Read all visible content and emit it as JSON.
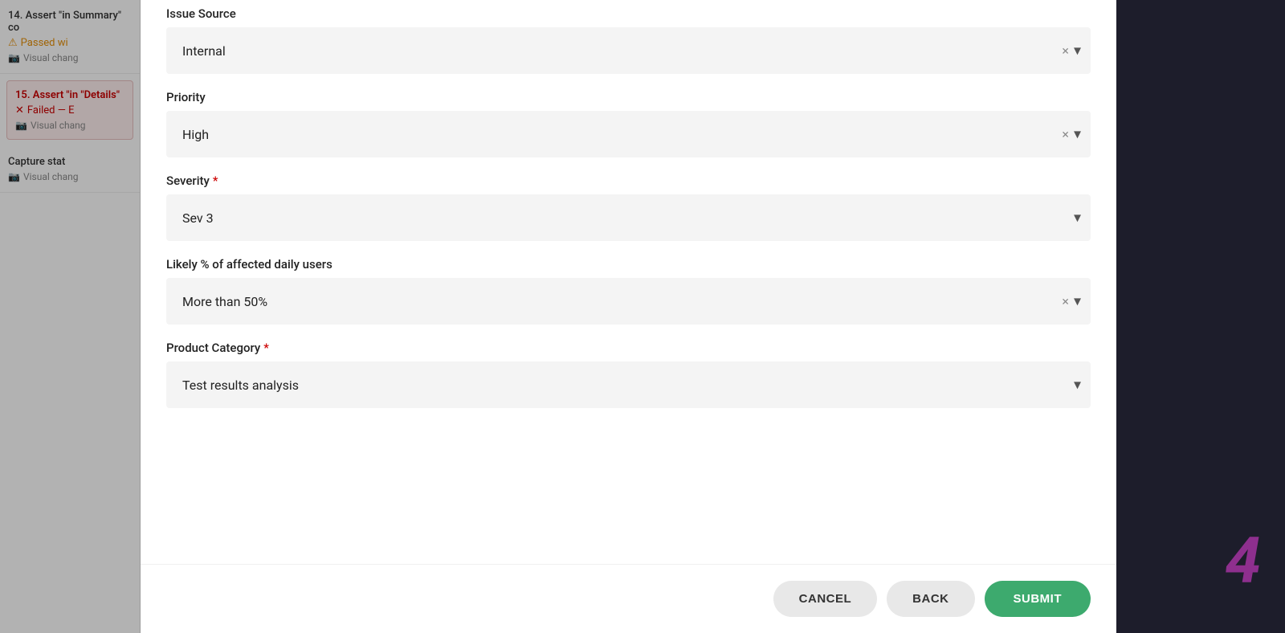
{
  "sidebar": {
    "items": [
      {
        "id": "item-14",
        "title": "14. Assert \"in Summary\" co",
        "status_label": "Passed wi",
        "status_type": "passed",
        "visual_label": "Visual chang"
      },
      {
        "id": "item-15",
        "title": "15. Assert \"in \"Details\"",
        "status_label": "Failed — E",
        "status_type": "failed",
        "visual_label": "Visual chang"
      },
      {
        "id": "item-capture",
        "title": "Capture stat",
        "visual_label": "Visual chang"
      }
    ]
  },
  "modal": {
    "fields": [
      {
        "id": "issue-source",
        "label": "Issue Source",
        "required": false,
        "value": "Internal",
        "has_clear": true,
        "has_chevron": true
      },
      {
        "id": "priority",
        "label": "Priority",
        "required": false,
        "value": "High",
        "has_clear": true,
        "has_chevron": true
      },
      {
        "id": "severity",
        "label": "Severity",
        "required": true,
        "value": "Sev 3",
        "has_clear": false,
        "has_chevron": true
      },
      {
        "id": "affected-users",
        "label": "Likely % of affected daily users",
        "required": false,
        "value": "More than 50%",
        "has_clear": true,
        "has_chevron": true
      },
      {
        "id": "product-category",
        "label": "Product Category",
        "required": true,
        "value": "Test results analysis",
        "has_clear": false,
        "has_chevron": true
      }
    ],
    "footer": {
      "cancel_label": "CANCEL",
      "back_label": "BACK",
      "submit_label": "SUBMIT"
    }
  },
  "step_badge": "4",
  "icons": {
    "warning": "⚠",
    "camera": "📷",
    "x_mark": "✕",
    "chevron_down": "▾",
    "clear": "×"
  }
}
